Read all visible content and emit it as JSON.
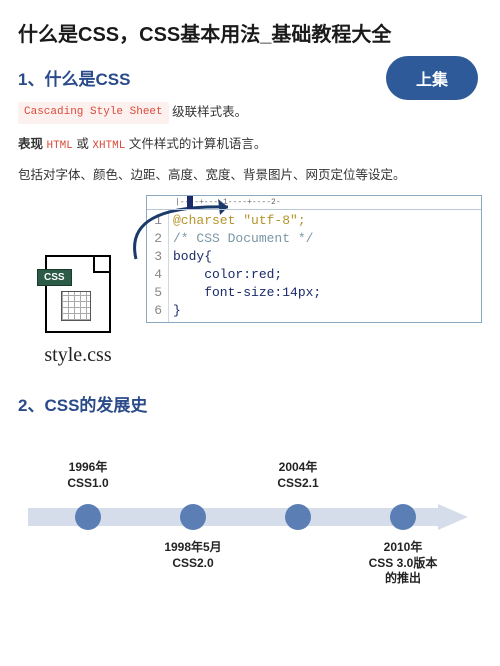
{
  "title": "什么是CSS，CSS基本用法_基础教程大全",
  "badge": "上集",
  "section1": {
    "heading": "1、什么是CSS",
    "chip_css": "Cascading Style Sheet",
    "chip_css_after": "  级联样式表。",
    "line2_prefix": "表现 ",
    "kw_html": "HTML",
    "line2_mid": " 或 ",
    "kw_xhtml": "XHTML",
    "line2_suffix": " 文件样式的计算机语言。",
    "line3": "包括对字体、颜色、边距、高度、宽度、背景图片、网页定位等设定。",
    "file_tab": "CSS",
    "filename": "style.css",
    "ruler": "|----+----1----+----2-",
    "code": {
      "l1": "@charset \"utf-8\";",
      "l2": "/* CSS Document */",
      "l3": "body{",
      "l4": "    color:red;",
      "l5": "    font-size:14px;",
      "l6": "}"
    }
  },
  "section2": {
    "heading": "2、CSS的发展史",
    "items": [
      {
        "year": "1996年",
        "ver": "CSS1.0",
        "pos": "top"
      },
      {
        "year": "1998年5月",
        "ver": "CSS2.0",
        "pos": "bottom"
      },
      {
        "year": "2004年",
        "ver": "CSS2.1",
        "pos": "top"
      },
      {
        "year": "2010年",
        "ver": "CSS 3.0版本",
        "extra": "的推出",
        "pos": "bottom"
      }
    ]
  }
}
